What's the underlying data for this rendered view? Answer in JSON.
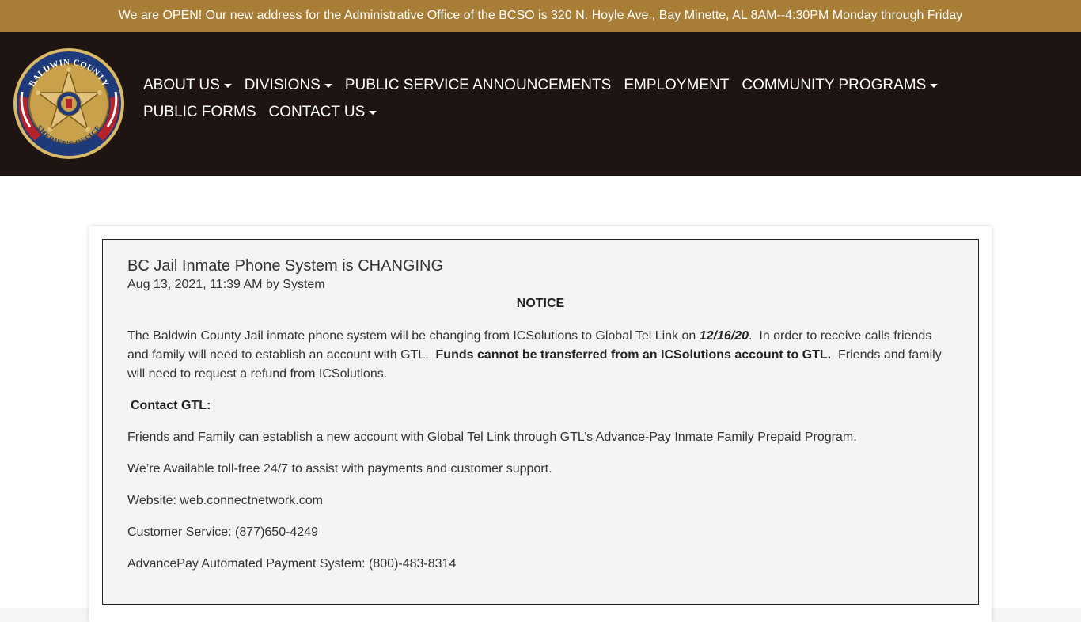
{
  "announcement": "We are OPEN! Our new address for the Administrative Office of the BCSO is 320 N. Hoyle Ave., Bay Minette, AL 8AM--4:30PM Monday through Friday",
  "logo": {
    "top_text": "BALDWIN COUNTY",
    "bottom_text": "SHERIFF'S OFFICE",
    "icon": "sheriff-badge-star"
  },
  "nav": {
    "items": [
      {
        "label": "ABOUT US",
        "dropdown": true
      },
      {
        "label": "DIVISIONS",
        "dropdown": true
      },
      {
        "label": "PUBLIC SERVICE ANNOUNCEMENTS",
        "dropdown": false
      },
      {
        "label": "EMPLOYMENT",
        "dropdown": false
      },
      {
        "label": "COMMUNITY PROGRAMS",
        "dropdown": true
      },
      {
        "label": "PUBLIC FORMS",
        "dropdown": false
      },
      {
        "label": "CONTACT US",
        "dropdown": true
      }
    ]
  },
  "article": {
    "title": "BC Jail Inmate Phone System is CHANGING",
    "meta": "Aug 13, 2021, 11:39 AM by System",
    "notice": "NOTICE",
    "p1_a": "The Baldwin County Jail inmate phone system will be changing from ICSolutions to Global Tel Link on ",
    "p1_date": "12/16/20",
    "p1_b": ".  In order to receive calls friends and family will need to establish an account with GTL.  ",
    "p1_bold": "Funds cannot be transferred from an ICSolutions account to GTL.",
    "p1_c": "  Friends and family will need to request a refund from ICSolutions.",
    "contact_heading": "Contact GTL:",
    "p2": "Friends and Family can establish a new account with Global Tel Link through GTL’s Advance-Pay Inmate Family Prepaid Program.",
    "p3": "We’re Available toll-free 24/7 to assist with payments and customer support.",
    "website": "Website: web.connectnetwork.com",
    "customer_service": "Customer Service: (877)650-4249",
    "advancepay": "AdvancePay Automated Payment System: (800)-483-8314"
  },
  "colors": {
    "announcement_bg": "#a87d35",
    "header_bg": "#1e1412",
    "badge_gold": "#c9a14a",
    "badge_blue": "#1e3a7a",
    "badge_red": "#b5222a"
  }
}
